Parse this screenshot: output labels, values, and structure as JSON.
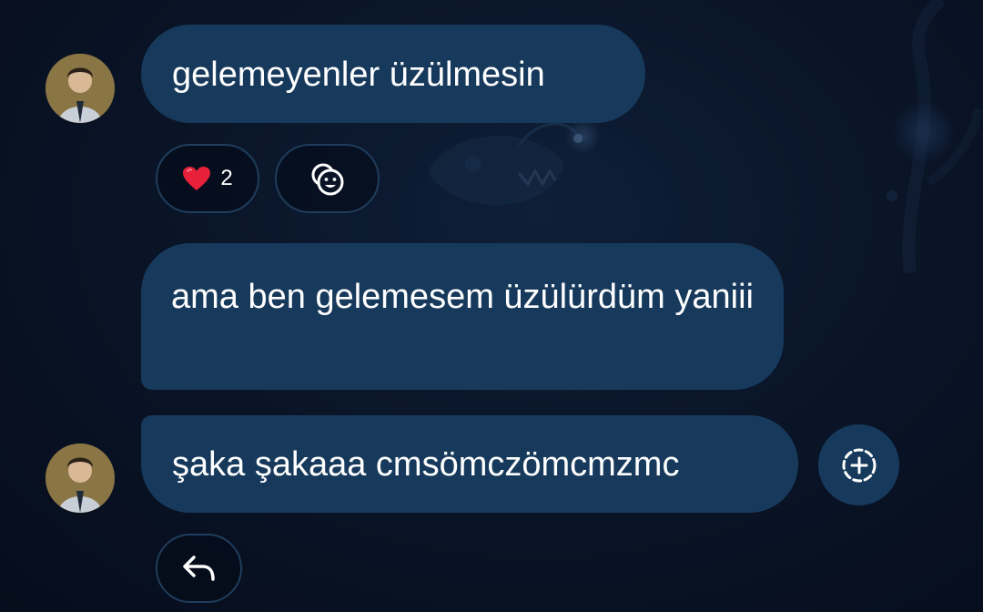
{
  "messages": [
    {
      "text": "gelemeyenler üzülmesin",
      "show_avatar": true,
      "reactions": [
        {
          "emoji": "heart-icon",
          "count": "2"
        }
      ],
      "add_reaction_icon": "smiley-add-icon"
    },
    {
      "text": "ama ben gelemesem üzülürdüm yaniii",
      "show_avatar": false
    },
    {
      "text": "şaka şakaaa cmsömczömcmzmc",
      "show_avatar": true,
      "side_action_icon": "dashed-plus-circle-icon",
      "reply_icon": "reply-arrow-icon"
    }
  ],
  "colors": {
    "bubble": "#173a5c",
    "background": "#0a1528",
    "heart": "#e8203a"
  }
}
